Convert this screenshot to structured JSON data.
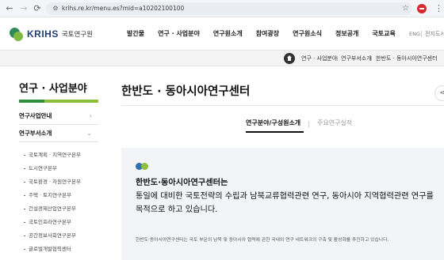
{
  "browser": {
    "url": "krihs.re.kr/menu.es?mid=a10202100100",
    "back_icon": "arrow-left-icon",
    "forward_icon": "arrow-right-icon",
    "reload_icon": "reload-icon"
  },
  "header": {
    "logo_text": "KRIHS",
    "logo_sub": "국토연구원",
    "nav": [
      "발간물",
      "연구 · 사업분야",
      "연구원소개",
      "참여광장",
      "연구원소식",
      "정보공개",
      "국토교육"
    ],
    "lang": "ENG",
    "sitemap": "전지도서"
  },
  "breadcrumb": [
    "연구 · 사업분야",
    "연구부서소개",
    "한반도 · 동아시아연구센터"
  ],
  "sidebar": {
    "title": "연구 · 사업분야",
    "rows": [
      {
        "label": "연구사업안내",
        "chevron": "›"
      },
      {
        "label": "연구부서소개",
        "chevron": "⌄"
      }
    ],
    "sub_items": [
      "국토계획 · 지역연구본부",
      "도시연구본부",
      "국토환경 · 자원연구본부",
      "주택 · 토지연구본부",
      "건설경제산업연구본부",
      "국토인프라연구본부",
      "공간정보사회연구본부",
      "글로벌개발협력센터"
    ]
  },
  "main": {
    "title": "한반도 · 동아시아연구센터",
    "share_icon": "share-icon",
    "tabs": [
      {
        "label": "연구분야/구성원소개",
        "active": true
      },
      {
        "label": "주요연구실적",
        "active": false
      }
    ],
    "intro_lines": [
      "한반도·동아시아연구센터는",
      "통일에 대비한 국토전략의 수립과 남북교류협력관련 연구, 동아시아 지역협력관련 연구를",
      "목적으로 하고 있습니다."
    ],
    "small_desc": "한반도·동아시아연구센터는 국토 부문의 남북 및 동아시아 협력에 관한 국내외 연구 네트워크의 구축 및 활성화를 추진하고 있습니다."
  },
  "colors": {
    "green_dark": "#2f8f3e",
    "green_light": "#8dbf3a",
    "blue": "#2f6fb3",
    "navy": "#1f3f7a"
  }
}
